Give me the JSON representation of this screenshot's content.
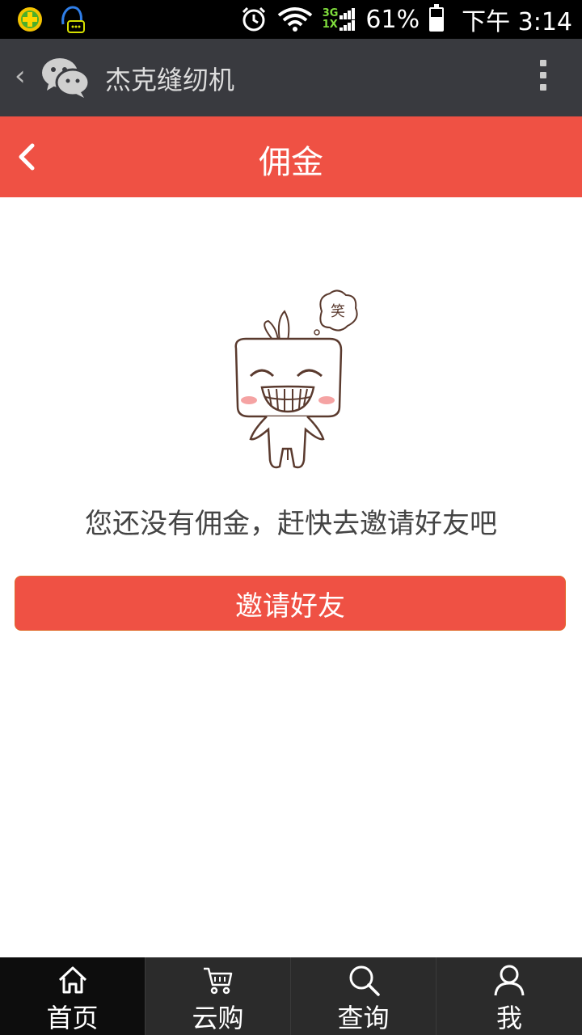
{
  "status_bar": {
    "network": "3G\n1X",
    "battery_text": "61%",
    "battery_level": 0.61,
    "time": "下午 3:14"
  },
  "wechat_bar": {
    "title": "杰克缝纫机"
  },
  "header": {
    "title": "佣金"
  },
  "mascot": {
    "bubble_text": "笑"
  },
  "content": {
    "empty_message": "您还没有佣金，赶快去邀请好友吧",
    "invite_button": "邀请好友"
  },
  "tabbar": {
    "tabs": [
      {
        "label": "首页",
        "icon": "home-icon"
      },
      {
        "label": "云购",
        "icon": "cart-icon"
      },
      {
        "label": "查询",
        "icon": "search-icon"
      },
      {
        "label": "我",
        "icon": "user-icon"
      }
    ]
  },
  "colors": {
    "accent": "#ef5144",
    "wechat_bar": "#393a3f",
    "tabbar": "#2b2b2b"
  }
}
